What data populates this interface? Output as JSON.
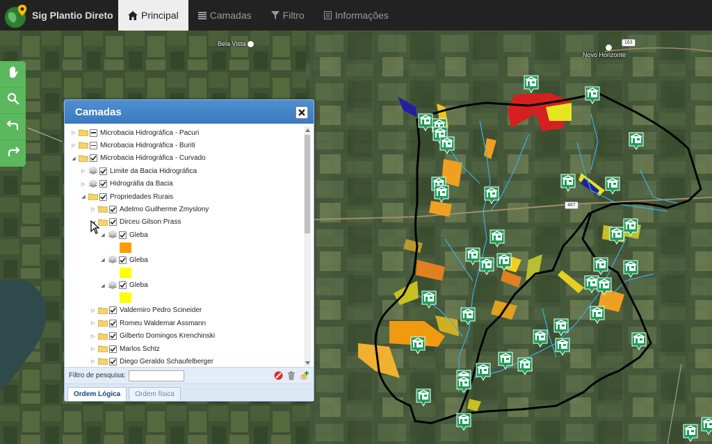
{
  "app": {
    "title": "Sig Plantio Direto"
  },
  "nav": {
    "items": [
      {
        "label": "Principal",
        "icon": "home-icon",
        "active": true
      },
      {
        "label": "Camadas",
        "icon": "list-icon",
        "active": false
      },
      {
        "label": "Filtro",
        "icon": "filter-icon",
        "active": false
      },
      {
        "label": "Informações",
        "icon": "document-icon",
        "active": false
      }
    ]
  },
  "toolbar": {
    "tools": [
      "pan-hand-icon",
      "zoom-search-icon",
      "undo-icon",
      "redo-icon"
    ]
  },
  "map": {
    "places": [
      "Bela Vista",
      "Novo Horizonte"
    ],
    "roads": [
      "163",
      "467"
    ]
  },
  "panel": {
    "title": "Camadas",
    "tree": [
      {
        "label": "Microbacia Hidrográfica - Pacuri",
        "state": "partial",
        "expanded": false
      },
      {
        "label": "Microbacia Hidrográfica - Buriti",
        "state": "partial",
        "expanded": false
      },
      {
        "label": "Microbacia Hidrográfica - Curvado",
        "state": "checked",
        "expanded": true
      },
      {
        "label": "Limite da Bacia Hidrográfica",
        "state": "checked",
        "expanded": false
      },
      {
        "label": "Hidrográfia da Bacia",
        "state": "checked",
        "expanded": false
      },
      {
        "label": "Propriedades Rurais",
        "state": "checked",
        "expanded": true
      },
      {
        "label": "Adelmo Guilherme Zmyslony",
        "state": "checked",
        "expanded": false
      },
      {
        "label": "Dirceu Gilson Prass",
        "state": "checked",
        "expanded": true
      },
      {
        "label": "Gleba",
        "state": "checked",
        "color": "#ff9c00"
      },
      {
        "label": "Gleba",
        "state": "checked",
        "color": "#ffff00"
      },
      {
        "label": "Gleba",
        "state": "checked",
        "color": "#ffff00"
      },
      {
        "label": "Valdemiro Pedro Scineider",
        "state": "checked",
        "expanded": false
      },
      {
        "label": "Romeu Waldemar Assmann",
        "state": "checked",
        "expanded": false
      },
      {
        "label": "Gilberto Domingos Krenchinski",
        "state": "checked",
        "expanded": false
      },
      {
        "label": "Marlos Schtz",
        "state": "checked",
        "expanded": false
      },
      {
        "label": "Diego Geraldo Schaufelberger",
        "state": "checked",
        "expanded": false
      }
    ],
    "filter_label": "Filtro de pesquisa:",
    "filter_value": "",
    "tabs": [
      {
        "label": "Ordem Lógica",
        "active": true
      },
      {
        "label": "Ordem física",
        "active": false
      }
    ]
  },
  "colors": {
    "navbar": "#222222",
    "toolbar": "#5cb85c",
    "panel_header": "#3b7ac0",
    "marker": "#1e9e5a"
  }
}
